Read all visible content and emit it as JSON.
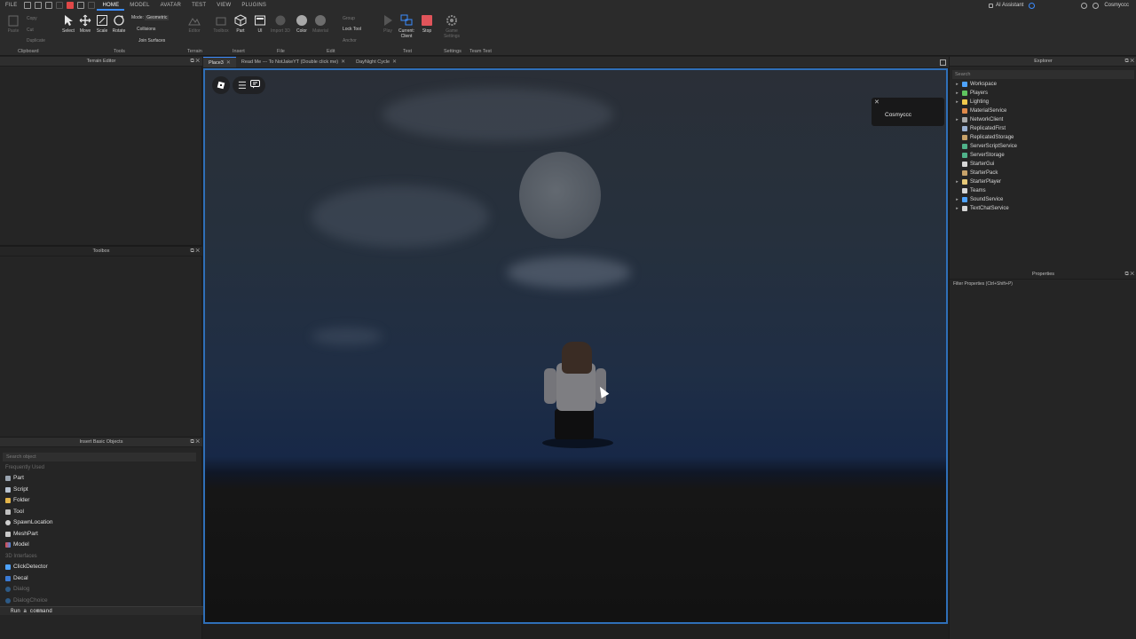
{
  "menubar": {
    "file": "FILE",
    "tabs": [
      "HOME",
      "MODEL",
      "AVATAR",
      "TEST",
      "VIEW",
      "PLUGINS"
    ],
    "assistant": "AI Assistant",
    "user": "Cosmyccc"
  },
  "ribbon": {
    "clipboard": {
      "paste": "Paste",
      "copy": "Copy",
      "cut": "Cut",
      "duplicate": "Duplicate",
      "label": "Clipboard"
    },
    "tools": {
      "select": "Select",
      "move": "Move",
      "scale": "Scale",
      "rotate": "Rotate",
      "mode_label": "Mode:",
      "mode_value": "Geometric",
      "collisions": "Collisions",
      "join_surfaces": "Join Surfaces",
      "label": "Tools"
    },
    "terrain": {
      "editor": "Editor",
      "label": "Terrain"
    },
    "insert": {
      "toolbox": "Toolbox",
      "part": "Part",
      "ui": "UI",
      "label": "Insert"
    },
    "file": {
      "import3d": "Import 3D",
      "label": "File"
    },
    "edit": {
      "color": "Color",
      "material": "Material",
      "group": "Group",
      "lock_tool": "Lock Tool",
      "anchor": "Anchor",
      "label": "Edit"
    },
    "test": {
      "play": "Play",
      "current_client_1": "Current:",
      "current_client_2": "Client",
      "stop": "Stop",
      "label": "Test"
    },
    "settings": {
      "game_settings": "Game Settings",
      "label": "Settings"
    },
    "team_test": {
      "label": "Team Test"
    }
  },
  "panels": {
    "terrain_editor": "Terrain Editor",
    "toolbox": "Toolbox",
    "insert_basic_objects": "Insert Basic Objects",
    "explorer": "Explorer",
    "properties": "Properties"
  },
  "insert_objects": {
    "search_placeholder": "Search object",
    "frequently_used": "Frequently Used",
    "items": [
      "Part",
      "Script",
      "Folder",
      "Tool",
      "SpawnLocation",
      "MeshPart",
      "Model"
    ],
    "interfaces_label": "3D Interfaces",
    "interface_items": [
      "ClickDetector",
      "Decal",
      "Dialog",
      "DialogChoice"
    ]
  },
  "command_bar": {
    "placeholder": "Run a command"
  },
  "doc_tabs": [
    {
      "label": "Place3"
    },
    {
      "label": "Read Me --- To NotJakeYT (Double click me)"
    },
    {
      "label": "DayNight Cycle"
    }
  ],
  "viewport": {
    "player_name": "Cosmyccc"
  },
  "explorer": {
    "search_placeholder": "Search",
    "items": [
      {
        "name": "Workspace",
        "icon_color": "#4ea3ff",
        "expandable": true
      },
      {
        "name": "Players",
        "icon_color": "#5fc55f",
        "expandable": true
      },
      {
        "name": "Lighting",
        "icon_color": "#f2c94c",
        "expandable": true
      },
      {
        "name": "MaterialService",
        "icon_color": "#e08a4a",
        "expandable": false
      },
      {
        "name": "NetworkClient",
        "icon_color": "#a8a8a8",
        "expandable": true
      },
      {
        "name": "ReplicatedFirst",
        "icon_color": "#9ab0d0",
        "expandable": false
      },
      {
        "name": "ReplicatedStorage",
        "icon_color": "#c7a26a",
        "expandable": false
      },
      {
        "name": "ServerScriptService",
        "icon_color": "#4fb38a",
        "expandable": false
      },
      {
        "name": "ServerStorage",
        "icon_color": "#4fb38a",
        "expandable": false
      },
      {
        "name": "StarterGui",
        "icon_color": "#d6d6d6",
        "expandable": false
      },
      {
        "name": "StarterPack",
        "icon_color": "#c7a26a",
        "expandable": false
      },
      {
        "name": "StarterPlayer",
        "icon_color": "#e6c878",
        "expandable": true
      },
      {
        "name": "Teams",
        "icon_color": "#d6d6d6",
        "expandable": false
      },
      {
        "name": "SoundService",
        "icon_color": "#4ea3ff",
        "expandable": true
      },
      {
        "name": "TextChatService",
        "icon_color": "#d6d6d6",
        "expandable": true
      }
    ]
  },
  "properties": {
    "filter_placeholder": "Filter Properties (Ctrl+Shift+P)"
  }
}
